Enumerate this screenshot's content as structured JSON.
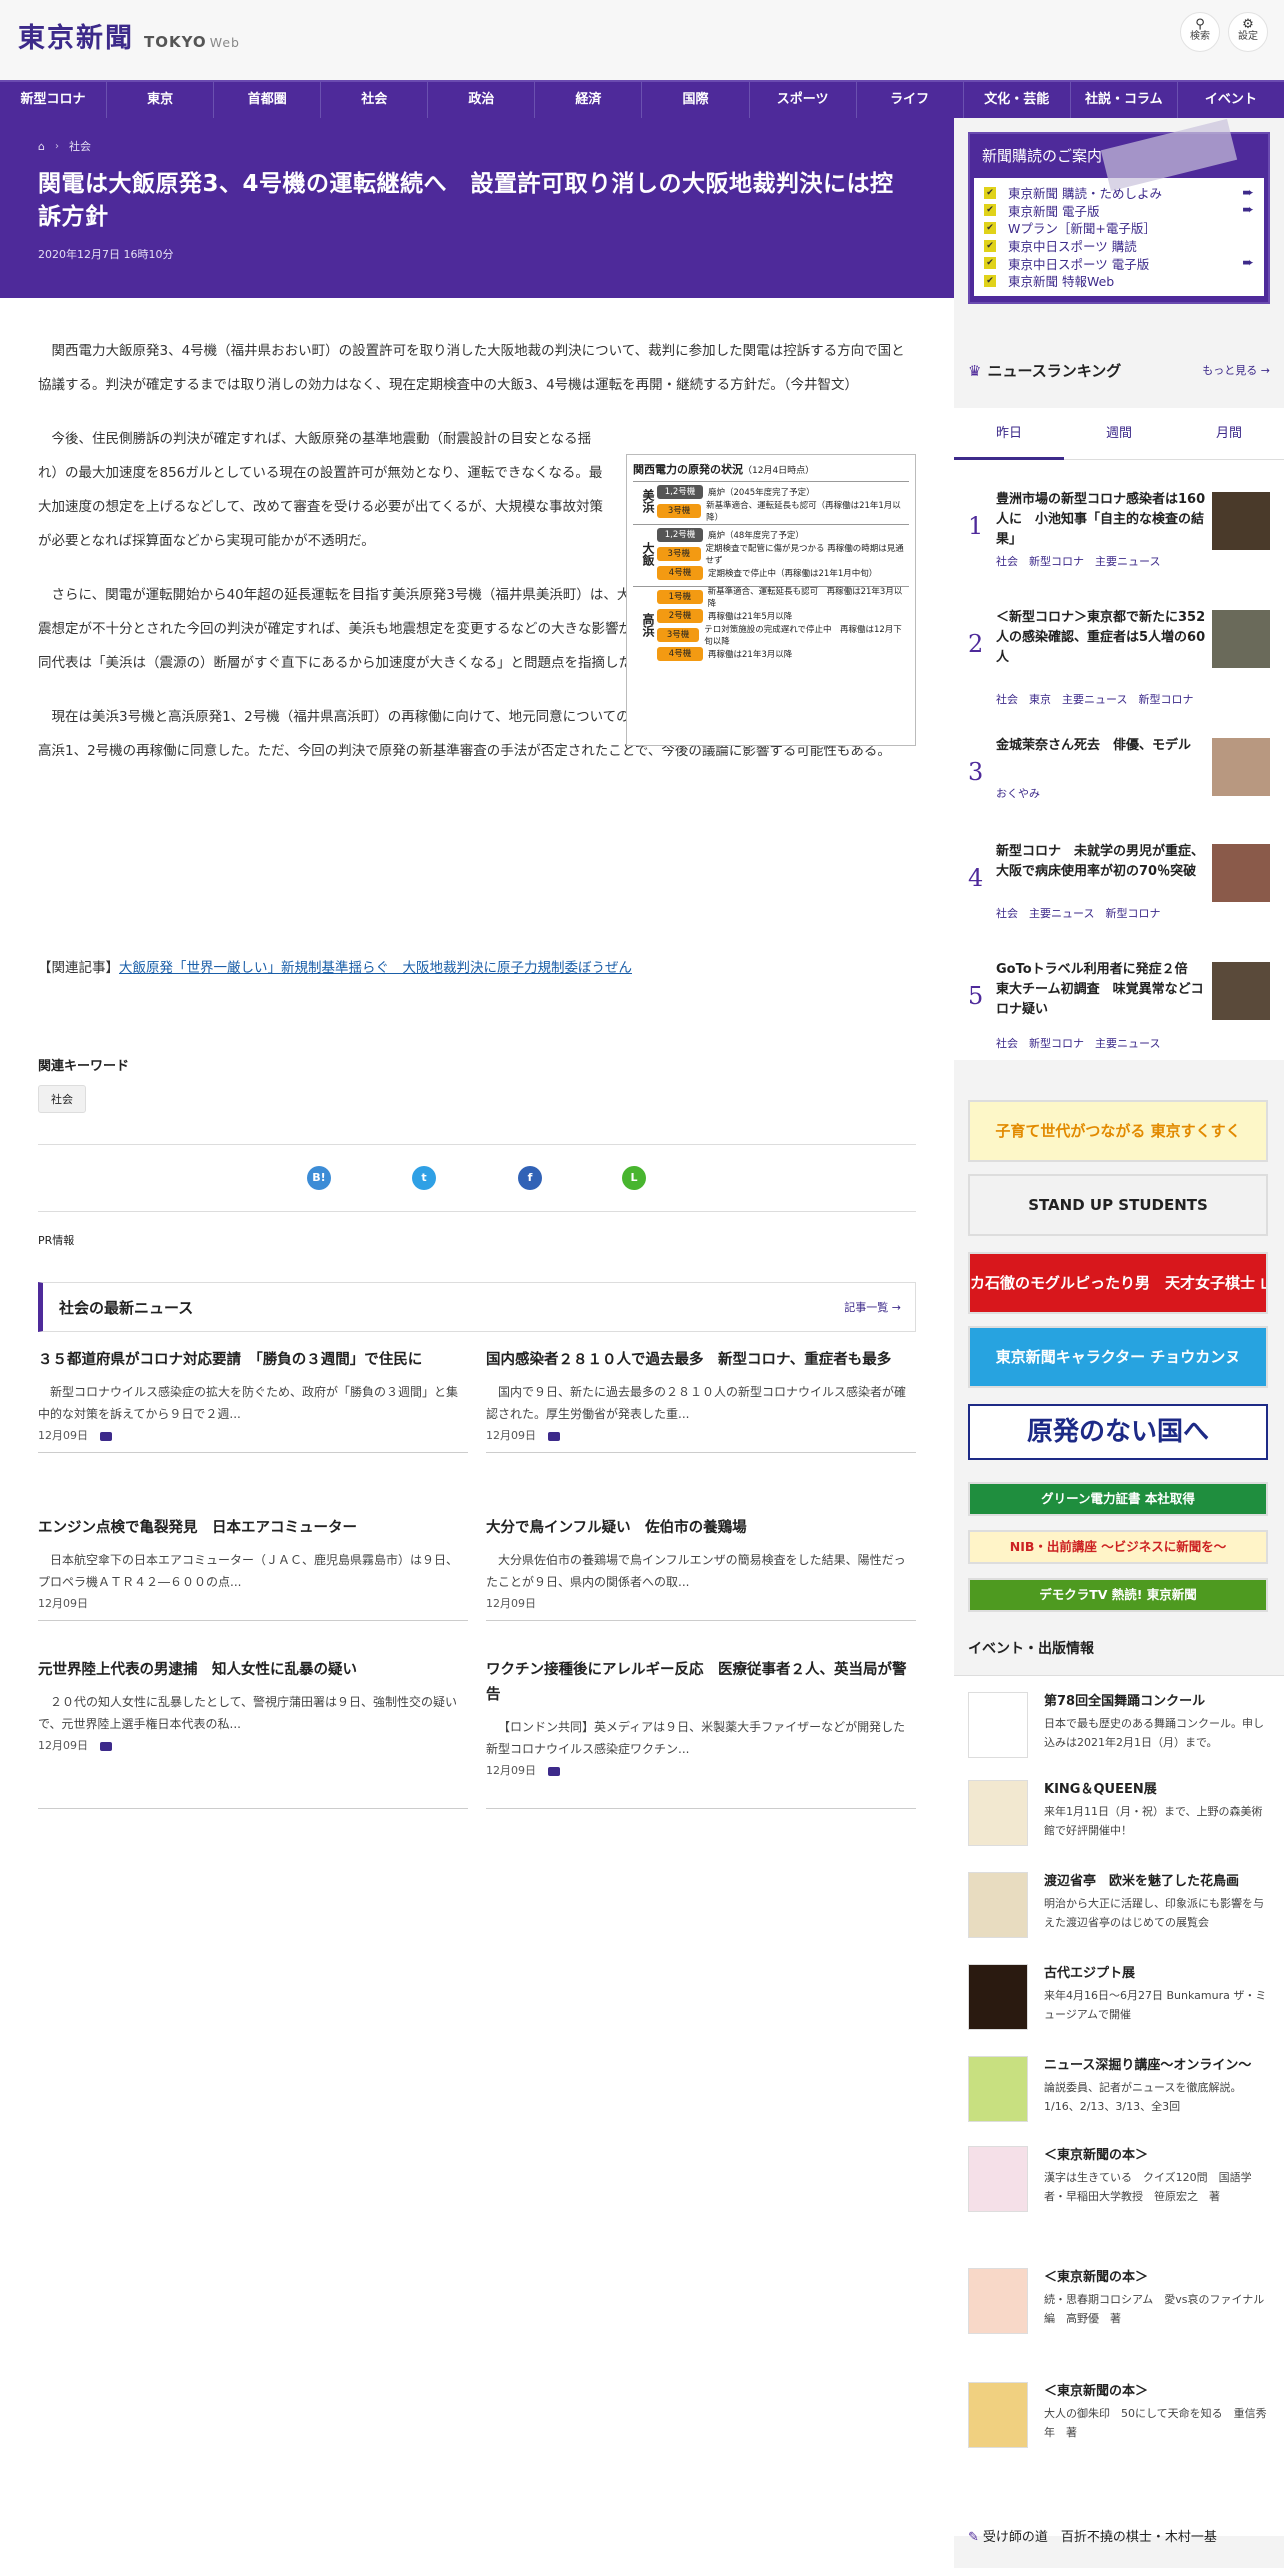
{
  "header": {
    "logo_ja": "東京新聞",
    "logo_en": "TOKYO",
    "logo_en_small": "Web",
    "search_label": "検索",
    "settings_label": "設定"
  },
  "nav": [
    "新型コロナ",
    "東京",
    "首都圏",
    "社会",
    "政治",
    "経済",
    "国際",
    "スポーツ",
    "ライフ",
    "文化・芸能",
    "社説・コラム",
    "イベント"
  ],
  "breadcrumb": {
    "category": "社会"
  },
  "article": {
    "title": "関電は大飯原発3、4号機の運転継続へ　設置許可取り消しの大阪地裁判決には控訴方針",
    "date": "2020年12月7日 16時10分",
    "paragraphs": [
      "関西電力大飯原発3、4号機（福井県おおい町）の設置許可を取り消した大阪地裁の判決について、裁判に参加した関電は控訴する方向で国と協議する。判決が確定するまでは取り消しの効力はなく、現在定期検査中の大飯3、4号機は運転を再開・継続する方針だ。（今井智文）",
      "今後、住民側勝訴の判決が確定すれば、大飯原発の基準地震動（耐震設計の目安となる揺れ）の最大加速度を856ガルとしている現在の設置許可が無効となり、運転できなくなる。最大加速度の想定を上げるなどして、改めて審査を受ける必要が出てくるが、大規模な事故対策が必要となれば採算面などから実現可能かが不透明だ。",
      "さらに、関電が運転開始から40年超の延長運転を目指す美浜原発3号機（福井県美浜町）は、大飯を上回る最大加速度993ガルとしており、地震想定が不十分とされた今回の判決が確定すれば、美浜も地震想定を変更するなどの大きな影響がありうる。判決後の原告団の会見で小山英之共同代表は「美浜は（震源の）断層がすぐ直下にあるから加速度が大きくなる」と問題点を指摘した。",
      "現在は美浜3号機と高浜原発1、2号機（福井県高浜町）の再稼働に向けて、地元同意についての議論が進んでおり、高浜町議会は11月25日に高浜1、2号機の再稼働に同意した。ただ、今回の判決で原発の新基準審査の手法が否定されたことで、今後の議論に影響する可能性もある。"
    ],
    "related_prefix": "【関連記事】",
    "related_link": "大飯原発「世界一厳しい」新規制基準揺らぐ　大阪地裁判決に原子力規制委ぼうぜん",
    "keywords_label": "関連キーワード",
    "keyword": "社会",
    "pr_label": "PR情報"
  },
  "figure": {
    "title": "関西電力の原発の状況",
    "note": "（12月4日時点）",
    "groups": [
      {
        "site": "美浜",
        "rows": [
          {
            "unit": "1,2号機",
            "dark": true,
            "text": "廃炉（2045年度完了予定）"
          },
          {
            "unit": "3号機",
            "dark": false,
            "text": "新基準適合、運転延長も認可（再稼働は21年1月以降）"
          }
        ]
      },
      {
        "site": "大飯",
        "rows": [
          {
            "unit": "1,2号機",
            "dark": true,
            "text": "廃炉（48年度完了予定）"
          },
          {
            "unit": "3号機",
            "dark": false,
            "text": "定期検査で配管に傷が見つかる 再稼働の時期は見通せず"
          },
          {
            "unit": "4号機",
            "dark": false,
            "text": "定期検査で停止中（再稼働は21年1月中旬）"
          }
        ]
      },
      {
        "site": "高浜",
        "rows": [
          {
            "unit": "1号機",
            "dark": false,
            "text": "新基準適合、運転延長も認可　再稼働は21年3月以降"
          },
          {
            "unit": "2号機",
            "dark": false,
            "text": "再稼働は21年5月以降"
          },
          {
            "unit": "3号機",
            "dark": false,
            "text": "テロ対策施設の完成遅れで停止中　再稼働は12月下旬以降"
          },
          {
            "unit": "4号機",
            "dark": false,
            "text": "再稼働は21年3月以降"
          }
        ]
      }
    ]
  },
  "share": [
    {
      "name": "hatena",
      "label": "B!",
      "color": "#3c8cd6"
    },
    {
      "name": "twitter",
      "label": "t",
      "color": "#2fa0e5"
    },
    {
      "name": "facebook",
      "label": "f",
      "color": "#3162b6"
    },
    {
      "name": "line",
      "label": "L",
      "color": "#48b52f"
    }
  ],
  "latest": {
    "title": "社会の最新ニュース",
    "more": "記事一覧",
    "items": [
      {
        "h": "３５都道府県がコロナ対応要請　「勝負の３週間」で住民に",
        "s": "新型コロナウイルス感染症の拡大を防ぐため、政府が「勝負の３週間」と集中的な対策を訴えてから９日で２週...",
        "d": "12月09日",
        "cam": true
      },
      {
        "h": "国内感染者２８１０人で過去最多　新型コロナ、重症者も最多",
        "s": "国内で９日、新たに過去最多の２８１０人の新型コロナウイルス感染者が確認された。厚生労働省が発表した重...",
        "d": "12月09日",
        "cam": true
      },
      {
        "h": "エンジン点検で亀裂発見　日本エアコミューター",
        "s": "日本航空傘下の日本エアコミューター（ＪＡＣ、鹿児島県霧島市）は９日、プロペラ機ＡＴＲ４２―６００の点...",
        "d": "12月09日",
        "cam": false
      },
      {
        "h": "大分で鳥インフル疑い　佐伯市の養鶏場",
        "s": "大分県佐伯市の養鶏場で鳥インフルエンザの簡易検査をした結果、陽性だったことが９日、県内の関係者への取...",
        "d": "12月09日",
        "cam": false
      },
      {
        "h": "元世界陸上代表の男逮捕　知人女性に乱暴の疑い",
        "s": "２０代の知人女性に乱暴したとして、警視庁蒲田署は９日、強制性交の疑いで、元世界陸上選手権日本代表の私...",
        "d": "12月09日",
        "cam": true
      },
      {
        "h": "ワクチン接種後にアレルギー反応　医療従事者２人、英当局が警告",
        "s": "【ロンドン共同】英メディアは９日、米製薬大手ファイザーなどが開発した新型コロナウイルス感染症ワクチン...",
        "d": "12月09日",
        "cam": true
      }
    ]
  },
  "subscribe": {
    "title": "新聞購読のご案内",
    "items": [
      "東京新聞 購読・ためしよみ",
      "東京新聞 電子版",
      "Wプラン［新聞+電子版］",
      "東京中日スポーツ 購読",
      "東京中日スポーツ 電子版",
      "東京新聞 特報Web"
    ],
    "arrows": [
      true,
      true,
      false,
      false,
      true,
      false
    ]
  },
  "ranking": {
    "title": "ニュースランキング",
    "more": "もっと見る",
    "tabs": [
      "昨日",
      "週間",
      "月間"
    ],
    "items": [
      {
        "n": "1",
        "h": "豊洲市場の新型コロナ感染者は160人に　小池知事「自主的な検査の結果」",
        "tags": "社会　新型コロナ　主要ニュース",
        "thumb": "#4a3a2a"
      },
      {
        "n": "2",
        "h": "＜新型コロナ＞東京都で新たに352人の感染確認、重症者は5人増の60人",
        "tags": "社会　東京　主要ニュース　新型コロナ",
        "thumb": "#6a6a5a"
      },
      {
        "n": "3",
        "h": "金城茉奈さん死去　俳優、モデル",
        "tags": "おくやみ",
        "thumb": "#b89880"
      },
      {
        "n": "4",
        "h": "新型コロナ　未就学の男児が重症、大阪で病床使用率が初の70％突破",
        "tags": "社会　主要ニュース　新型コロナ",
        "thumb": "#8a5a4a"
      },
      {
        "n": "5",
        "h": "GoToトラベル利用者に発症２倍　東大チーム初調査　味覚異常などコロナ疑い",
        "tags": "社会　新型コロナ　主要ニュース",
        "thumb": "#5a4a3a"
      }
    ]
  },
  "banners": [
    {
      "name": "sukusuku",
      "text": "子育て世代がつながる 東京すくすく",
      "bg": "#fdf7c8",
      "fg": "#e28a00"
    },
    {
      "name": "standup-students",
      "text": "STAND UP STUDENTS",
      "bg": "#f2f2f2",
      "fg": "#222"
    },
    {
      "name": "yamasaki",
      "text": "カ石徹のモグルピったり男　天才女子棋士 山崎 照朝",
      "bg": "#d8171c",
      "fg": "#fff"
    },
    {
      "name": "chokanu",
      "text": "東京新聞キャラクター チョウカンヌ",
      "bg": "#27a3e0",
      "fg": "#fff"
    },
    {
      "name": "genpatsu",
      "text": "原発のない国へ",
      "bg": "#fff",
      "fg": "#1d2a86"
    },
    {
      "name": "green-power",
      "text": "グリーン電力証書 本社取得",
      "bg": "#1f8e3e",
      "fg": "#fff"
    },
    {
      "name": "nib",
      "text": "NIB・出前講座 〜ビジネスに新聞を〜",
      "bg": "#fff4c8",
      "fg": "#c22"
    },
    {
      "name": "democra-tv",
      "text": "デモクラTV 熱読! 東京新聞",
      "bg": "#4e9a20",
      "fg": "#fff"
    }
  ],
  "events": {
    "title": "イベント・出版情報",
    "items": [
      {
        "h": "第78回全国舞踊コンクール",
        "s": "日本で最も歴史のある舞踊コンクール。申し込みは2021年2月1日（月）まで。",
        "bg": "#fff"
      },
      {
        "h": "KING＆QUEEN展",
        "s": "来年1月11日（月・祝）まで、上野の森美術館で好評開催中！",
        "bg": "#f2e8d0"
      },
      {
        "h": "渡辺省亭　欧米を魅了した花鳥画",
        "s": "明治から大正に活躍し、印象派にも影響を与えた渡辺省亭のはじめての展覧会",
        "bg": "#e8dcc0"
      },
      {
        "h": "古代エジプト展",
        "s": "来年4月16日～6月27日 Bunkamura ザ・ミュージアムで開催",
        "bg": "#2a1a10"
      },
      {
        "h": "ニュース深掘り講座～オンライン～",
        "s": "論説委員、記者がニュースを徹底解説。1/16、2/13、3/13、全3回",
        "bg": "#c8e080"
      },
      {
        "h": "＜東京新聞の本＞",
        "s": "漢字は生きている　クイズ120問　国語学者・早稲田大学教授　笹原宏之　著",
        "bg": "#f5e0e8"
      },
      {
        "h": "＜東京新聞の本＞",
        "s": "続・思春期コロシアム　愛vs哀のファイナル編　高野優　著",
        "bg": "#f8d8c8"
      },
      {
        "h": "＜東京新聞の本＞",
        "s": "大人の御朱印　50にして天命を知る　重信秀年　著",
        "bg": "#f0d080"
      }
    ]
  },
  "footlink": "受け師の道　百折不撓の棋士・木村一基"
}
